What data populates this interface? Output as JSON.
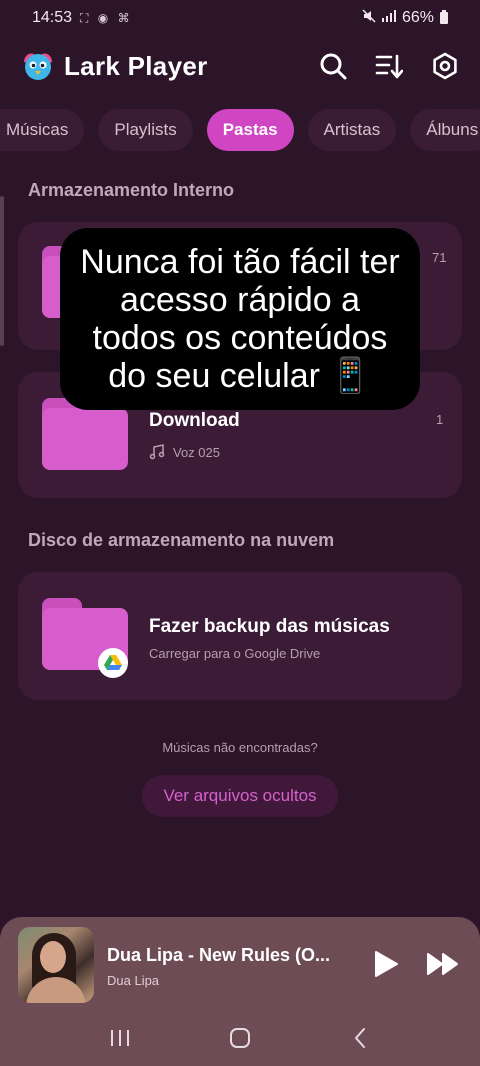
{
  "status_bar": {
    "time": "14:53",
    "glyphs": "⛶ ◉ ⌘",
    "battery": "66%"
  },
  "header": {
    "app_name": "Lark Player"
  },
  "tabs": [
    {
      "label": "Músicas",
      "active": false
    },
    {
      "label": "Playlists",
      "active": false
    },
    {
      "label": "Pastas",
      "active": true
    },
    {
      "label": "Artistas",
      "active": false
    },
    {
      "label": "Álbuns",
      "active": false
    }
  ],
  "internal": {
    "section_title": "Armazenamento Interno",
    "folders": [
      {
        "title": "",
        "count": "71"
      },
      {
        "title": "Download",
        "subtitle": "Voz 025",
        "count": "1"
      }
    ]
  },
  "overlay": {
    "caption": "Nunca foi tão fácil ter acesso rápido a todos os conteúdos do seu celular 📱"
  },
  "cloud": {
    "section_title": "Disco de armazenamento na nuvem",
    "title": "Fazer backup das músicas",
    "subtitle": "Carregar para o Google Drive"
  },
  "footer": {
    "not_found": "Músicas não encontradas?",
    "hidden_button": "Ver arquivos ocultos"
  },
  "player": {
    "title": "Dua Lipa - New Rules (O...",
    "artist": "Dua Lipa"
  },
  "colors": {
    "accent": "#cf45c2",
    "background": "#2c1528",
    "card": "#3b1b36",
    "player": "#6e4c55"
  }
}
